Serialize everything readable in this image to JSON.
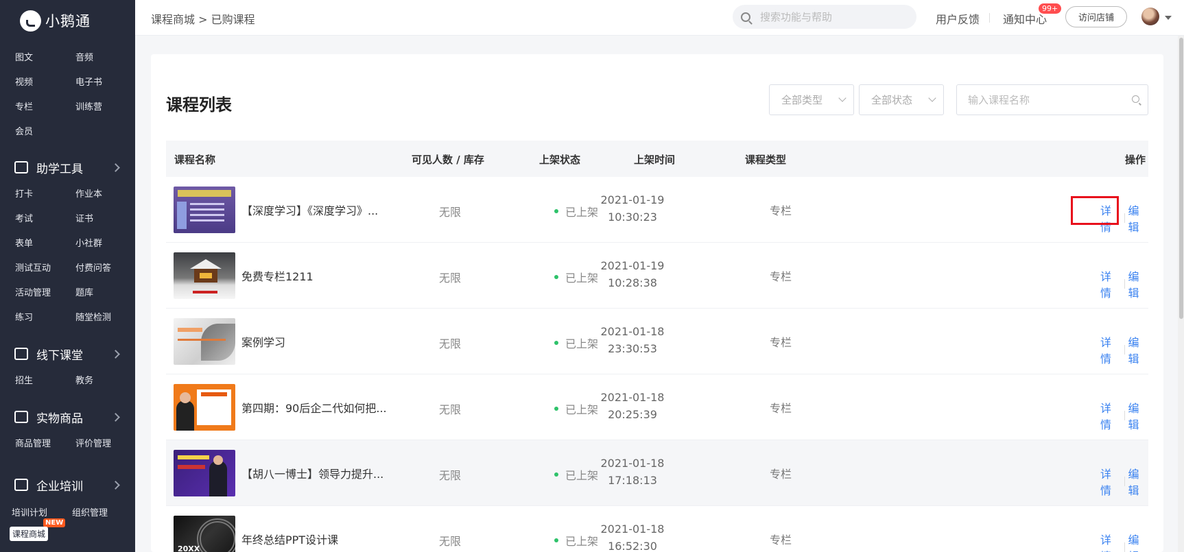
{
  "brand": {
    "name": "小鹅通"
  },
  "sidebar": {
    "top_items": [
      "图文",
      "音频",
      "视频",
      "电子书",
      "专栏",
      "训练营",
      "会员"
    ],
    "groups": [
      {
        "title": "助学工具",
        "icon": "briefcase-icon",
        "items": [
          "打卡",
          "作业本",
          "考试",
          "证书",
          "表单",
          "小社群",
          "测试互动",
          "付费问答",
          "活动管理",
          "题库",
          "练习",
          "随堂检测"
        ]
      },
      {
        "title": "线下课堂",
        "icon": "classroom-icon",
        "items": [
          "招生",
          "教务"
        ]
      },
      {
        "title": "实物商品",
        "icon": "shopping-bag-icon",
        "items": [
          "商品管理",
          "评价管理"
        ]
      },
      {
        "title": "企业培训",
        "icon": "mail-icon",
        "items": [
          "培训计划",
          "组织管理"
        ]
      }
    ],
    "course_mall": {
      "label": "课程商城",
      "badge": "NEW"
    }
  },
  "topbar": {
    "breadcrumb": "课程商城 > 已购课程",
    "search_placeholder": "搜索功能与帮助",
    "feedback": "用户反馈",
    "notifications": "通知中心",
    "notification_badge": "99+",
    "visit_store": "访问店铺"
  },
  "page": {
    "title": "课程列表",
    "filter_type": "全部类型",
    "filter_status": "全部状态",
    "keyword_placeholder": "输入课程名称"
  },
  "table": {
    "columns": {
      "name": "课程名称",
      "visible": "可见人数 / 库存",
      "status": "上架状态",
      "time": "上架时间",
      "type": "课程类型",
      "actions": "操作"
    },
    "rows": [
      {
        "name": "【深度学习】《深度学习》...",
        "visible": "无限",
        "status": "已上架",
        "date": "2021-01-19",
        "time": "10:30:23",
        "type": "专栏",
        "detail": "详情",
        "edit": "编辑"
      },
      {
        "name": "免费专栏1211",
        "visible": "无限",
        "status": "已上架",
        "date": "2021-01-19",
        "time": "10:28:38",
        "type": "专栏",
        "detail": "详情",
        "edit": "编辑"
      },
      {
        "name": "案例学习",
        "visible": "无限",
        "status": "已上架",
        "date": "2021-01-18",
        "time": "23:30:53",
        "type": "专栏",
        "detail": "详情",
        "edit": "编辑"
      },
      {
        "name": "第四期：90后企二代如何把...",
        "visible": "无限",
        "status": "已上架",
        "date": "2021-01-18",
        "time": "20:25:39",
        "type": "专栏",
        "detail": "详情",
        "edit": "编辑"
      },
      {
        "name": "【胡八一博士】领导力提升...",
        "visible": "无限",
        "status": "已上架",
        "date": "2021-01-18",
        "time": "17:18:13",
        "type": "专栏",
        "detail": "详情",
        "edit": "编辑"
      },
      {
        "name": "年终总结PPT设计课",
        "visible": "无限",
        "status": "已上架",
        "date": "2021-01-18",
        "time": "16:52:30",
        "type": "专栏",
        "detail": "详情",
        "edit": "编辑"
      }
    ]
  },
  "thumb_text": {
    "row6": "20XX"
  },
  "colors": {
    "sidebar_bg": "#262b3a",
    "link": "#3a82f0",
    "status_dot": "#2ec26a",
    "badge": "#ff4d4f",
    "highlight_box": "#e8101c"
  }
}
